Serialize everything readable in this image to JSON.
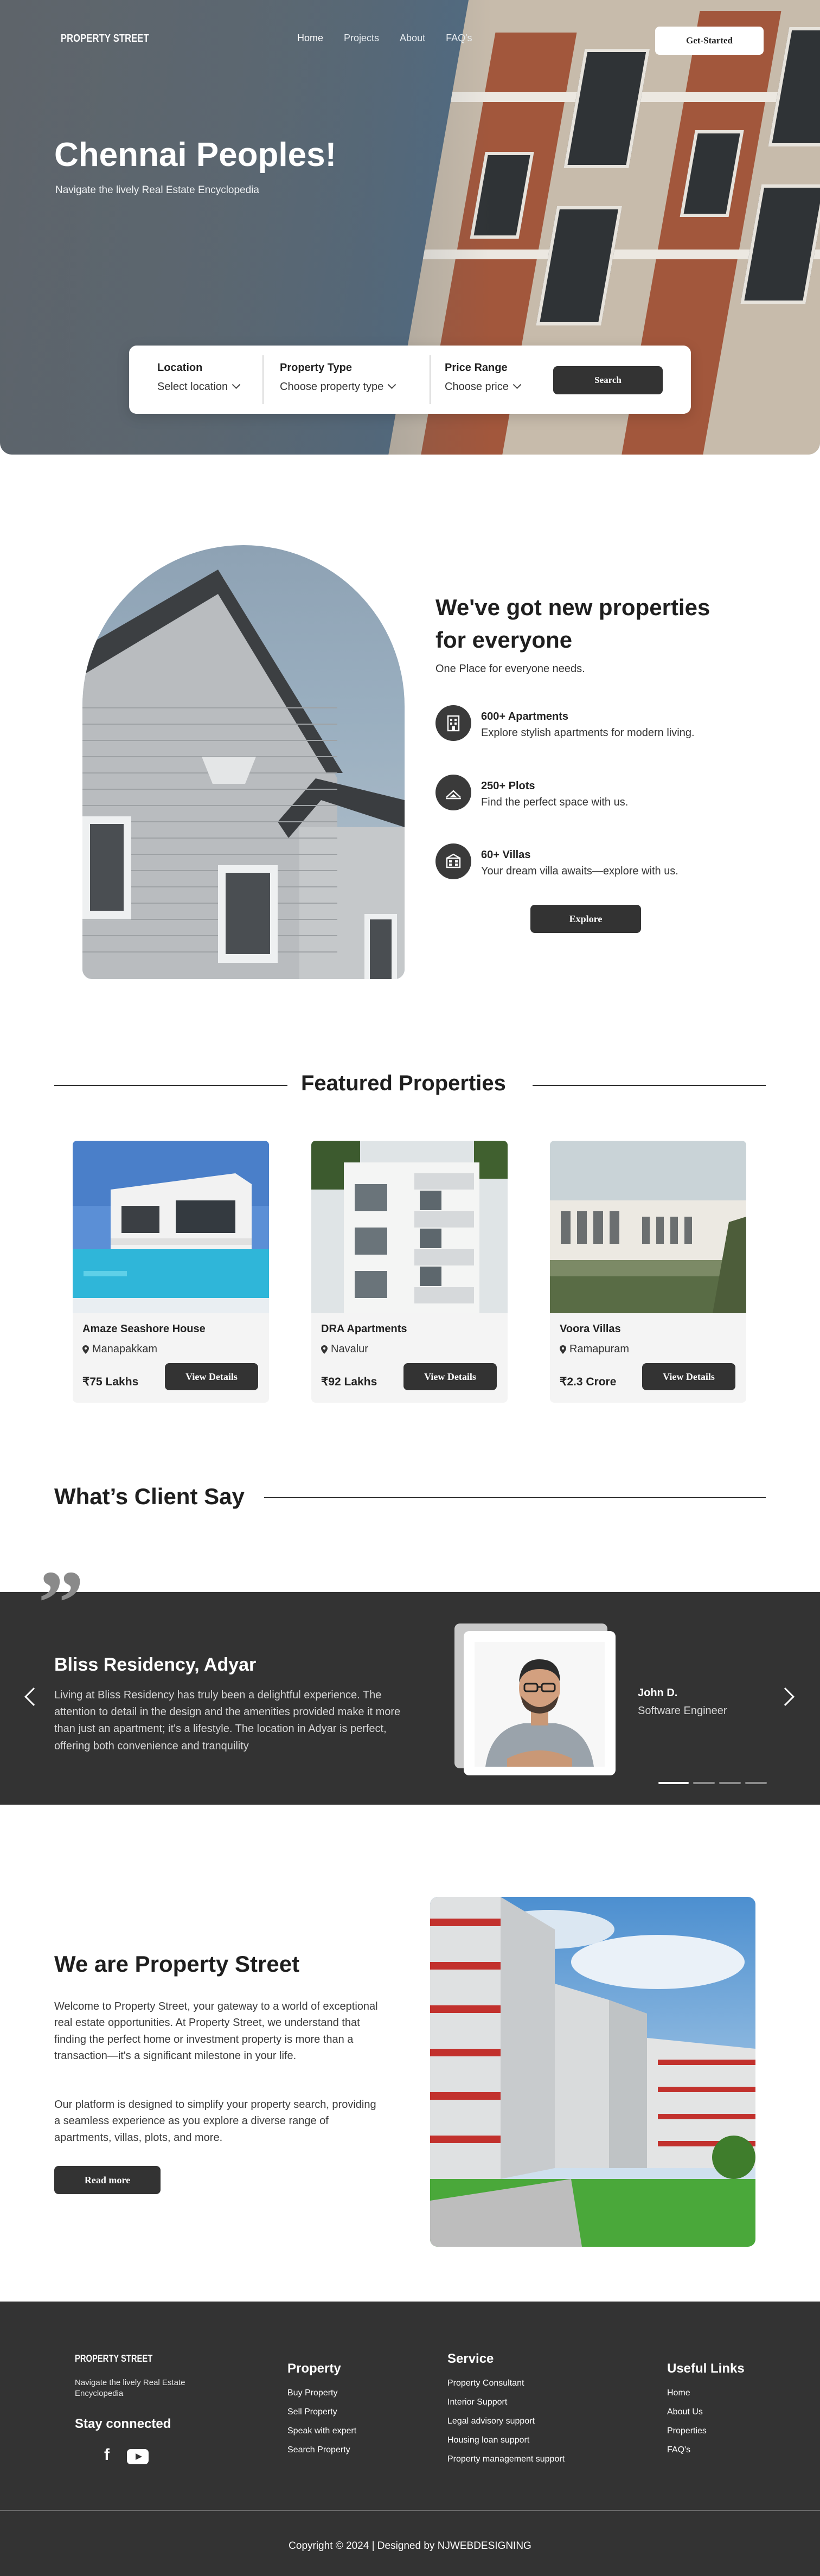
{
  "nav": {
    "logo": "PROPERTY STREET",
    "links": [
      "Home",
      "Projects",
      "About",
      "FAQ's"
    ],
    "cta": "Get-Started"
  },
  "hero": {
    "title": "Chennai Peoples!",
    "subtitle": "Navigate the lively Real Estate Encyclopedia"
  },
  "search": {
    "location": {
      "label": "Location",
      "value": "Select location"
    },
    "type": {
      "label": "Property Type",
      "value": "Choose property type"
    },
    "price": {
      "label": "Price Range",
      "value": "Choose price"
    },
    "button": "Search"
  },
  "new_properties": {
    "title": "We've got new properties for everyone",
    "subtitle": "One Place for everyone needs.",
    "features": [
      {
        "icon": "building-icon",
        "title": "600+ Apartments",
        "desc": "Explore stylish apartments for modern living."
      },
      {
        "icon": "plot-icon",
        "title": "250+ Plots",
        "desc": "Find the perfect space with us."
      },
      {
        "icon": "villa-icon",
        "title": "60+ Villas",
        "desc": "Your dream villa awaits—explore with us."
      }
    ],
    "button": "Explore"
  },
  "featured": {
    "title": "Featured Properties",
    "cards": [
      {
        "name": "Amaze Seashore House",
        "location": "Manapakkam",
        "price": "₹75 Lakhs",
        "button": "View Details"
      },
      {
        "name": "DRA Apartments",
        "location": "Navalur",
        "price": "₹92 Lakhs",
        "button": "View Details"
      },
      {
        "name": "Voora Villas",
        "location": "Ramapuram",
        "price": "₹2.3 Crore",
        "button": "View Details"
      }
    ]
  },
  "testimonials": {
    "title": "What’s Client Say",
    "heading": "Bliss Residency, Adyar",
    "text": "Living at Bliss Residency has truly been a delightful experience. The attention to detail in the design and the amenities provided make it more than just an apartment; it's a lifestyle. The location in Adyar is perfect, offering both convenience and tranquility",
    "name": "John D.",
    "role": "Software Engineer",
    "slide_count": 4,
    "active_slide": 1
  },
  "about": {
    "title": "We are Property Street",
    "para1": "Welcome to Property Street, your gateway to a world of exceptional real estate opportunities. At Property Street, we understand that finding the perfect home or investment property is more than a transaction—it's a significant milestone in your life.",
    "para2": "Our platform is designed to simplify your property search, providing a seamless experience as you explore a diverse range of apartments, villas, plots, and more.",
    "button": "Read more"
  },
  "footer": {
    "logo": "PROPERTY STREET",
    "tagline": "Navigate the lively Real Estate Encyclopedia",
    "stay": "Stay connected",
    "social": [
      "facebook-icon",
      "youtube-icon"
    ],
    "property": {
      "title": "Property",
      "items": [
        "Buy Property",
        "Sell Property",
        "Speak with expert",
        "Search Property"
      ]
    },
    "service": {
      "title": "Service",
      "items": [
        "Property Consultant",
        "Interior Support",
        "Legal advisory support",
        "Housing loan support",
        "Property management support"
      ]
    },
    "links": {
      "title": "Useful Links",
      "items": [
        "Home",
        "About Us",
        "Properties",
        "FAQ's"
      ]
    },
    "copyright": "Copyright © 2024 | Designed by NJWEBDESIGNING"
  }
}
